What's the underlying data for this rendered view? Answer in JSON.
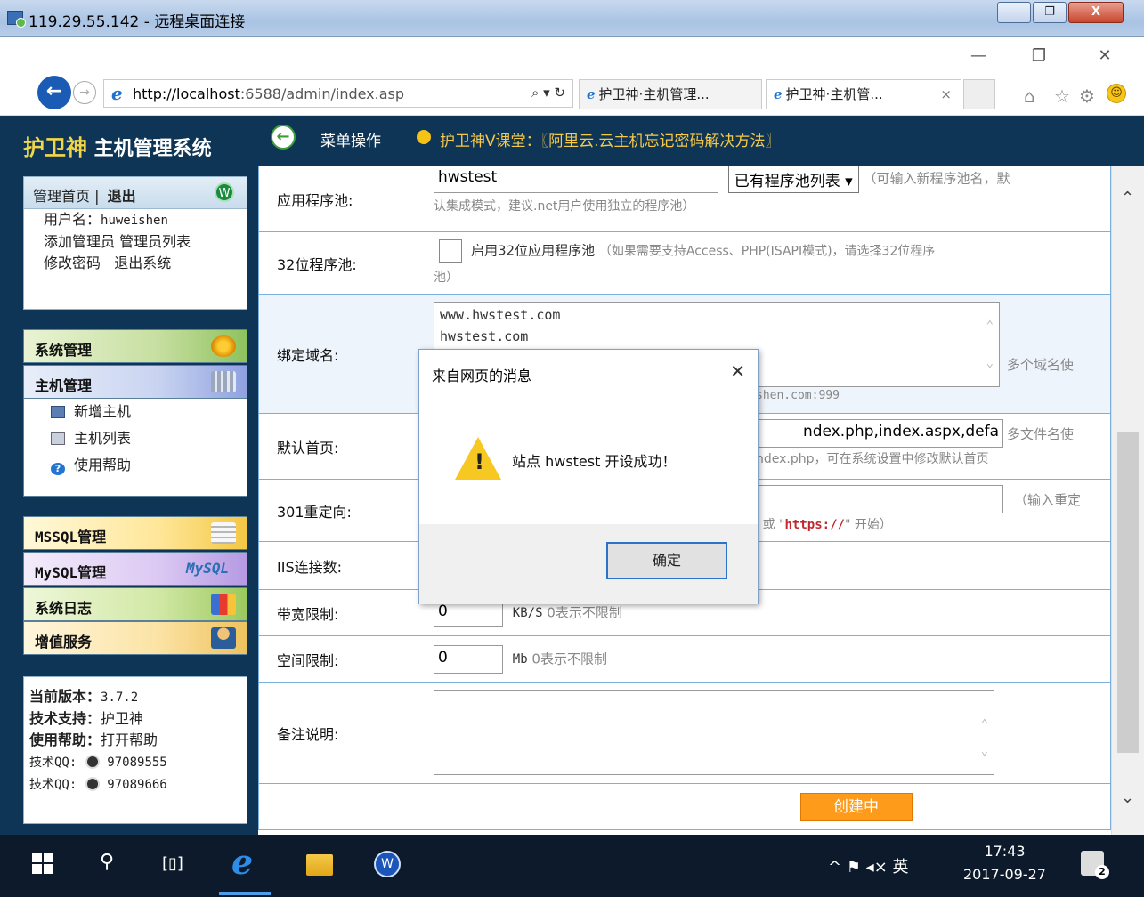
{
  "rdp": {
    "title": "119.29.55.142 - 远程桌面连接",
    "minimize": "—",
    "maximize": "❐",
    "close": "X"
  },
  "browser": {
    "minimize": "—",
    "restore": "❐",
    "close": "✕",
    "url_host": "http://localhost",
    "url_rest": ":6588/admin/index.asp",
    "addr_tools": "⌕ ▾ ↻",
    "tabs": [
      {
        "label": "护卫神·主机管理..."
      },
      {
        "label": "护卫神·主机管...",
        "close": "×"
      }
    ]
  },
  "sidebar": {
    "brand_main": "护卫神",
    "brand_sub": " 主机管理系统",
    "user_panel": {
      "home": "管理首页",
      "sep": " | ",
      "logout": "退出",
      "username_label": "用户名：",
      "username": "huweishen",
      "add_admin": "添加管理员",
      "admin_list": "管理员列表",
      "change_pwd": "修改密码",
      "exit_system": "退出系统"
    },
    "menus": {
      "system": "系统管理",
      "host": "主机管理",
      "host_items": [
        "新增主机",
        "主机列表",
        "使用帮助"
      ],
      "mssql": "MSSQL管理",
      "mysql": "MySQL管理",
      "mysql_logo": "MySQL",
      "logs": "系统日志",
      "vip": "增值服务"
    },
    "version_panel": {
      "version_label": "当前版本：",
      "version": "3.7.2",
      "support_label": "技术支持：",
      "support": "护卫神",
      "help_label": "使用帮助：",
      "help": "打开帮助",
      "qq_label": "技术QQ:",
      "qq1": "97089555",
      "qq2": "97089666"
    }
  },
  "topstrip": {
    "menu_op": "菜单操作",
    "lesson": "护卫神V课堂：〖阿里云.云主机忘记密码解决方法〗"
  },
  "form": {
    "app_pool": {
      "label": "应用程序池:",
      "value": "hwstest",
      "select": "已有程序池列表 ▾",
      "hint1": "（可输入新程序池名，默",
      "hint2": "认集成模式，建议.net用户使用独立的程序池）"
    },
    "pool32": {
      "label": "32位程序池:",
      "checkbox_label": "启用32位应用程序池",
      "hint1": "（如果需要支持Access、PHP(ISAPI模式)，请选择32位程序",
      "hint2": "池）"
    },
    "domains": {
      "label": "绑定域名:",
      "value": "www.hwstest.com\nhwstest.com",
      "hint": "多个域名使",
      "hint2": "shen.com:999"
    },
    "default_doc": {
      "label": "默认首页:",
      "value": "ndex.php,index.aspx,defa",
      "hint": "多文件名使",
      "hint2": "ndex.php，可在系统设置中修改默认首页"
    },
    "redirect": {
      "label": "301重定向:",
      "hint": "（输入重定",
      "hint2_a": "/\" 或 \"",
      "hint2_b": "https://",
      "hint2_c": "\" 开始）"
    },
    "iis_conn": {
      "label": "IIS连接数:"
    },
    "bandwidth": {
      "label": "带宽限制:",
      "value": "0",
      "unit": "KB/S",
      "hint": "0表示不限制"
    },
    "space": {
      "label": "空间限制:",
      "value": "0",
      "unit": "Mb",
      "hint": "0表示不限制"
    },
    "notes": {
      "label": "备注说明:"
    },
    "submit": "创建中"
  },
  "dialog": {
    "title": "来自网页的消息",
    "close": "✕",
    "message": "站点 hwstest 开设成功！",
    "ok": "确定"
  },
  "taskbar": {
    "tray": "^  ⚑  ◂×  英",
    "time": "17:43",
    "date": "2017-09-27"
  }
}
